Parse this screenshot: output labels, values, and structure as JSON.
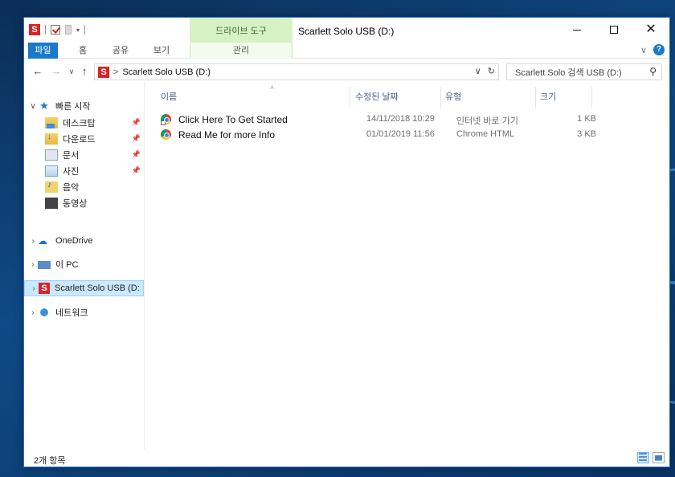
{
  "window": {
    "title": "Scarlett Solo USB (D:)",
    "app_icon_letter": "S",
    "context_tab_group": "드라이브 도구"
  },
  "ribbon": {
    "tabs": [
      "파일",
      "홈",
      "공유",
      "보기",
      "관리"
    ],
    "active_tab": "파일"
  },
  "address_bar": {
    "drive_icon_letter": "S",
    "separator": ">",
    "path": "Scarlett Solo USB (D:)",
    "dropdown_glyph": "∨",
    "refresh_glyph": "↻"
  },
  "search": {
    "placeholder": "Scarlett Solo 검색    USB (D:)"
  },
  "nav_pane": {
    "quick_access": "빠른 시작",
    "quick_items": [
      {
        "label": "데스크탑",
        "pinned": true
      },
      {
        "label": "다운로드",
        "pinned": true
      },
      {
        "label": "문서",
        "pinned": true
      },
      {
        "label": "사진",
        "pinned": true
      },
      {
        "label": "음악",
        "pinned": false
      },
      {
        "label": "동영상",
        "pinned": false
      }
    ],
    "onedrive": "OneDrive",
    "this_pc": "이 PC",
    "drive": "Scarlett Solo USB (D:",
    "network": "네트워크"
  },
  "columns": {
    "name": "이름",
    "date": "수정된 날짜",
    "type": "유형",
    "size": "크기"
  },
  "files": [
    {
      "name": "Click Here To Get Started",
      "date": "14/11/2018 10:29",
      "type": "인터넷 바로 가기",
      "size": "1 KB",
      "icon": "chrome-shortcut-icon"
    },
    {
      "name": "Read Me for more Info",
      "date": "01/01/2019 11:56",
      "type": "Chrome HTML",
      "size": "3 KB",
      "icon": "chrome-icon"
    }
  ],
  "status_bar": {
    "item_count": "2개 항목"
  },
  "colors": {
    "accent": "#1979ca",
    "selection": "#cce8ff",
    "context_tab": "#d6f2c4",
    "drive_red": "#d6242a"
  }
}
